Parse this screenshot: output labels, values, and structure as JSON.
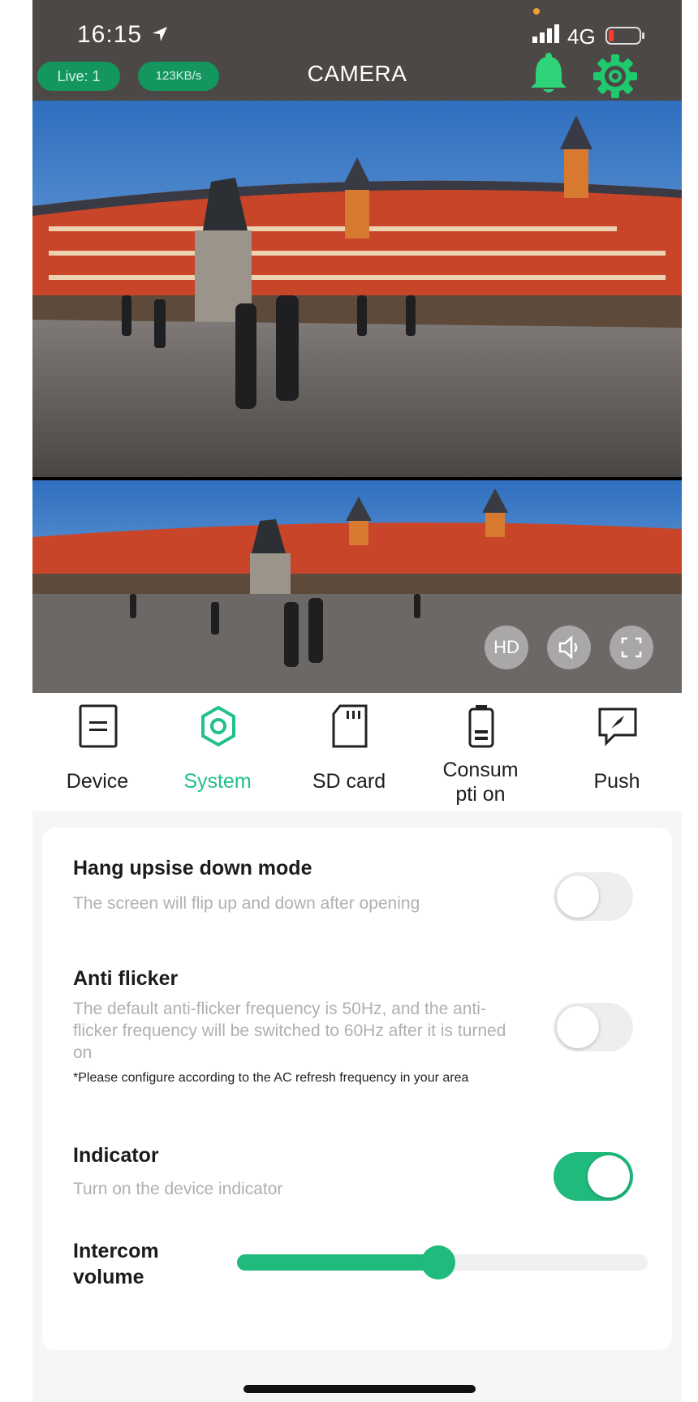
{
  "status_bar": {
    "time": "16:15",
    "network": "4G"
  },
  "header": {
    "live_badge": "Live: 1",
    "rate_badge": "123KB/s",
    "title": "CAMERA"
  },
  "video_controls": {
    "hd_label": "HD"
  },
  "tabs": [
    {
      "label": "Device",
      "icon": "device-icon"
    },
    {
      "label": "System",
      "icon": "system-icon",
      "active": true
    },
    {
      "label": "SD card",
      "icon": "sd-card-icon"
    },
    {
      "label": "Consumpti on",
      "icon": "battery-icon"
    },
    {
      "label": "Push",
      "icon": "push-icon"
    }
  ],
  "settings": {
    "hang": {
      "title": "Hang upsise down mode",
      "desc": "The screen will flip up and down after opening",
      "enabled": false
    },
    "flicker": {
      "title": "Anti flicker",
      "desc": "The default anti-flicker frequency is 50Hz, and the anti-flicker frequency will be switched to 60Hz after it is turned on",
      "note": "*Please configure according to the AC refresh frequency in your area",
      "enabled": false
    },
    "indicator": {
      "title": "Indicator",
      "desc": "Turn on the device indicator",
      "enabled": true
    },
    "volume": {
      "label": "Intercom volume",
      "level_percent": 49
    }
  },
  "colors": {
    "accent": "#1fba7c",
    "header_bg": "#4c4846",
    "badge_bg": "#14965f"
  }
}
